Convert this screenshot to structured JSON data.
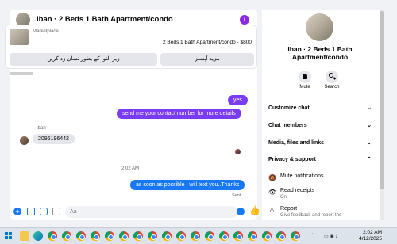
{
  "chat": {
    "title": "Iban · 2 Beds 1 Bath Apartment/condo",
    "info_icon": "info-icon",
    "marketplace": {
      "label": "Marketplace",
      "listing": "2 Beds 1 Bath Apartment/condo - $800",
      "button_left": "زیر التوا کے بطور نشان زد کریں",
      "button_right": "مزید آپشنز"
    },
    "messages": {
      "out_yes": "yes",
      "out_contact": "send me your contact number for more details",
      "sender_name": "Iban",
      "in_number": "2096196442",
      "timestamp": "2:02 AM",
      "out_text_soon": "as soon as possible I will text you..Thanks",
      "status": "Sent"
    },
    "composer": {
      "placeholder": "Aa"
    }
  },
  "profile": {
    "name": "Iban · 2 Beds 1 Bath Apartment/condo",
    "actions": [
      {
        "label": "Mute",
        "icon": "bell-icon"
      },
      {
        "label": "Search",
        "icon": "search-icon"
      }
    ],
    "sections": [
      "Customize chat",
      "Chat members",
      "Media, files and links",
      "Privacy & support"
    ],
    "items": [
      {
        "label": "Mute notifications",
        "sub": "",
        "icon": "bell-off-icon"
      },
      {
        "label": "Read receipts",
        "sub": "On",
        "icon": "eye-icon"
      },
      {
        "label": "Report",
        "sub": "Give feedback and report the",
        "icon": "report-icon"
      }
    ]
  },
  "taskbar": {
    "time": "2:02 AM",
    "date": "4/12/2025"
  }
}
